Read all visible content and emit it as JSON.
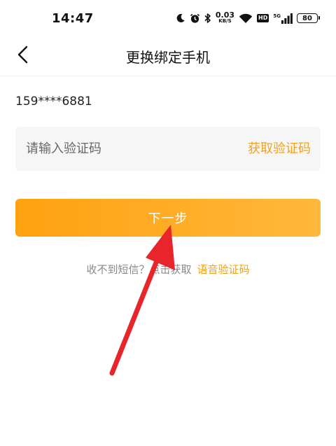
{
  "status_bar": {
    "time": "14:47",
    "net_speed_value": "0.03",
    "net_speed_unit": "KB/S",
    "hd_label": "HD",
    "signal_label": "5G",
    "battery_level": "80",
    "icons": [
      "moon-icon",
      "alarm-icon",
      "bluetooth-icon",
      "wifi-icon",
      "hd-icon",
      "cellular-signal-icon",
      "battery-icon"
    ]
  },
  "header": {
    "title": "更换绑定手机",
    "back_icon": "chevron-left-icon"
  },
  "phone": {
    "masked_number": "159****6881"
  },
  "code_input": {
    "placeholder": "请输入验证码",
    "value": "",
    "get_code_label": "获取验证码"
  },
  "next_button": {
    "label": "下一步"
  },
  "hint": {
    "text": "收不到短信？点击获取",
    "voice_code_label": "语音验证码"
  },
  "colors": {
    "accent": "#f0a21e",
    "button_gradient_start": "#ffa10f",
    "button_gradient_end": "#ffb83c",
    "annotation_arrow": "#e8252a"
  }
}
